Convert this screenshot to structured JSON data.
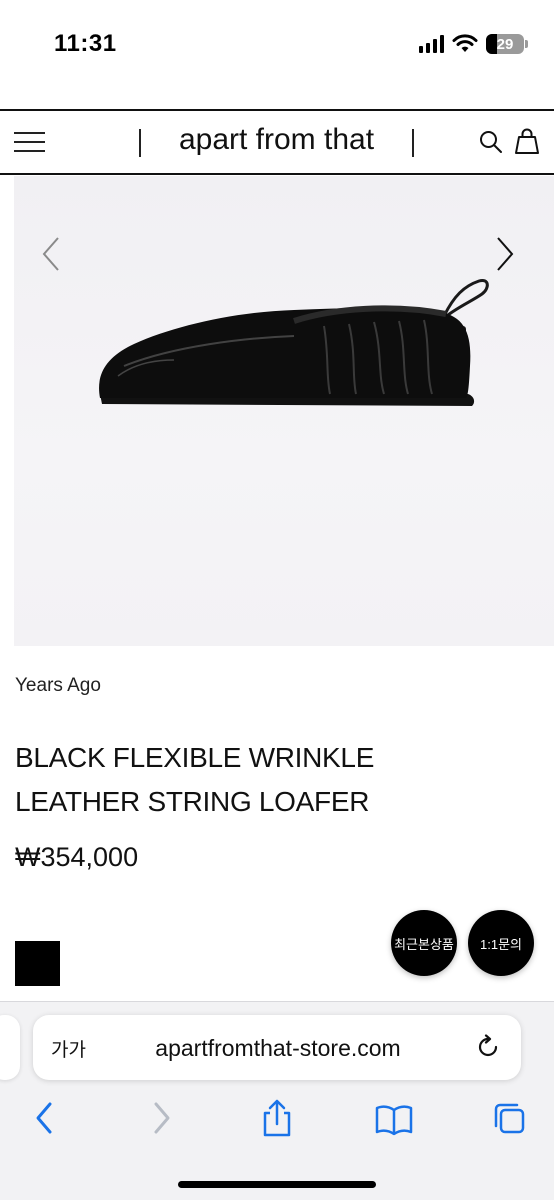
{
  "status_bar": {
    "time": "11:31",
    "battery_level": "29",
    "icons": [
      "signal-icon",
      "wifi-icon",
      "battery-icon"
    ]
  },
  "site_header": {
    "brand": "apart from that",
    "icons": [
      "hamburger-menu-icon",
      "search-icon",
      "shopping-bag-icon"
    ]
  },
  "product": {
    "brand": "Years Ago",
    "title": "BLACK FLEXIBLE WRINKLE LEATHER STRING LOAFER",
    "price": "₩354,000",
    "swatch_color": "#000000",
    "gallery_icons": [
      "chevron-left-icon",
      "chevron-right-icon"
    ]
  },
  "floating_buttons": {
    "recent": "최근본상품",
    "inquiry": "1:1문의"
  },
  "browser": {
    "aa_label": "가가",
    "url": "apartfromthat-store.com",
    "toolbar_icons": [
      "back-icon",
      "forward-icon",
      "share-icon",
      "bookmarks-icon",
      "tabs-icon"
    ],
    "accent_color": "#1a73e8"
  }
}
